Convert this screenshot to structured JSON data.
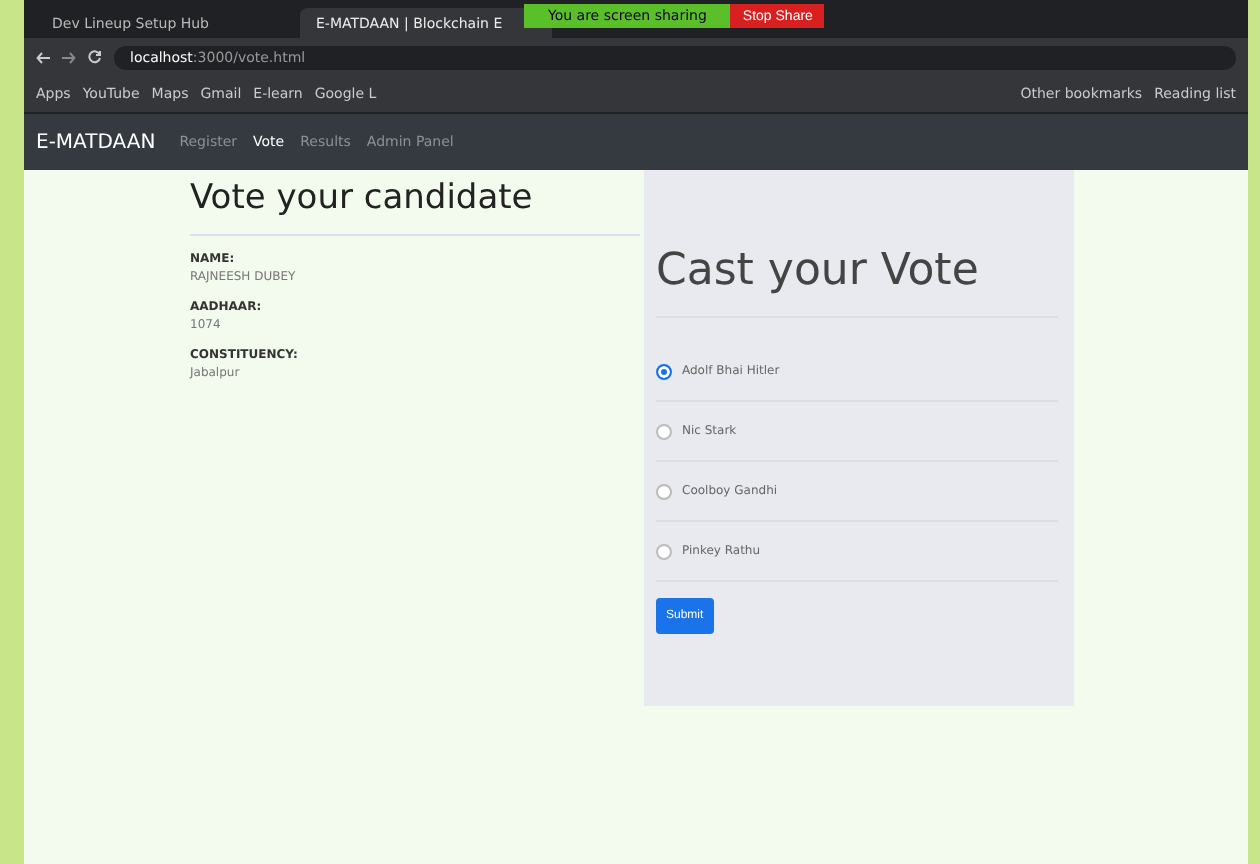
{
  "browser": {
    "tabs": [
      {
        "title": "Dev Lineup Setup Hub",
        "selected": false
      },
      {
        "title": "E-MATDAAN | Blockchain E",
        "selected": true
      }
    ],
    "share_banner": "You are screen sharing",
    "stop_button": "Stop Share",
    "address": {
      "host": "localhost",
      "path": ":3000/vote.html"
    },
    "bookmarks": [
      "Apps",
      "YouTube",
      "Maps",
      "Gmail",
      "E-learn",
      "Google L"
    ],
    "bookmarks_right": [
      "Other bookmarks",
      "Reading list"
    ]
  },
  "navbar": {
    "brand": "E-MATDAAN",
    "links": [
      {
        "label": "Register",
        "selected": false
      },
      {
        "label": "Vote",
        "selected": true
      },
      {
        "label": "Results",
        "selected": false
      },
      {
        "label": "Admin Panel",
        "selected": false
      }
    ]
  },
  "voter": {
    "title": "Vote your candidate",
    "fields": [
      {
        "label": "NAME:",
        "value": "RAJNEESH DUBEY"
      },
      {
        "label": "AADHAAR:",
        "value": "1074"
      },
      {
        "label": "CONSTITUENCY:",
        "value": "Jabalpur"
      }
    ]
  },
  "ballot": {
    "title": "Cast your Vote",
    "candidates": [
      {
        "name": "Adolf Bhai Hitler",
        "selected": true
      },
      {
        "name": "Nic Stark",
        "selected": false
      },
      {
        "name": "Coolboy Gandhi",
        "selected": false
      },
      {
        "name": "Pinkey Rathu",
        "selected": false
      }
    ],
    "submit": "Submit"
  }
}
